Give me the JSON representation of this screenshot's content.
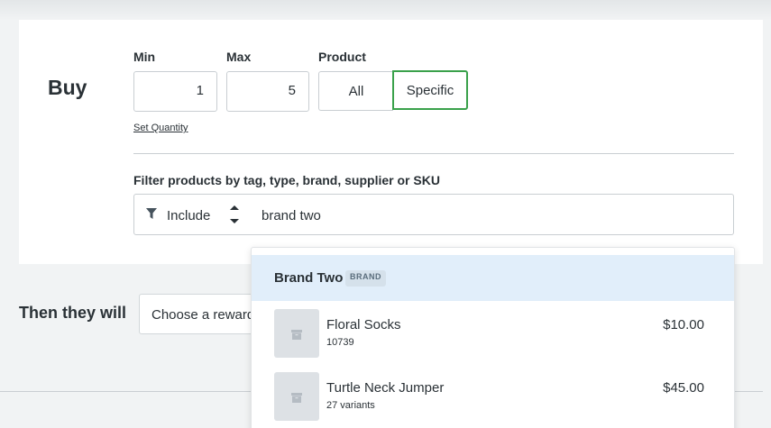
{
  "buy": {
    "title": "Buy",
    "min_label": "Min",
    "min_value": "1",
    "max_label": "Max",
    "max_value": "5",
    "product_label": "Product",
    "product_options": [
      "All",
      "Specific"
    ],
    "product_selected": "Specific",
    "set_quantity_link": "Set Quantity",
    "filter_label": "Filter products by tag, type, brand, supplier or SKU",
    "filter_mode": "Include",
    "search_value": "brand two"
  },
  "then": {
    "label": "Then they will",
    "reward_placeholder": "Choose a reward"
  },
  "dropdown": {
    "brand": {
      "name": "Brand Two",
      "badge": "BRAND"
    },
    "products": [
      {
        "name": "Floral Socks",
        "sub": "10739",
        "price": "$10.00"
      },
      {
        "name": "Turtle Neck Jumper",
        "sub": "27 variants",
        "price": "$45.00"
      }
    ]
  },
  "colors": {
    "accent_selected": "#3aa14b",
    "highlight_row": "#e1eefa",
    "background": "#f1f3f4"
  },
  "icons": {
    "filter": "filter-icon",
    "stepper": "up-down-stepper-icon",
    "product_placeholder": "box-icon"
  }
}
